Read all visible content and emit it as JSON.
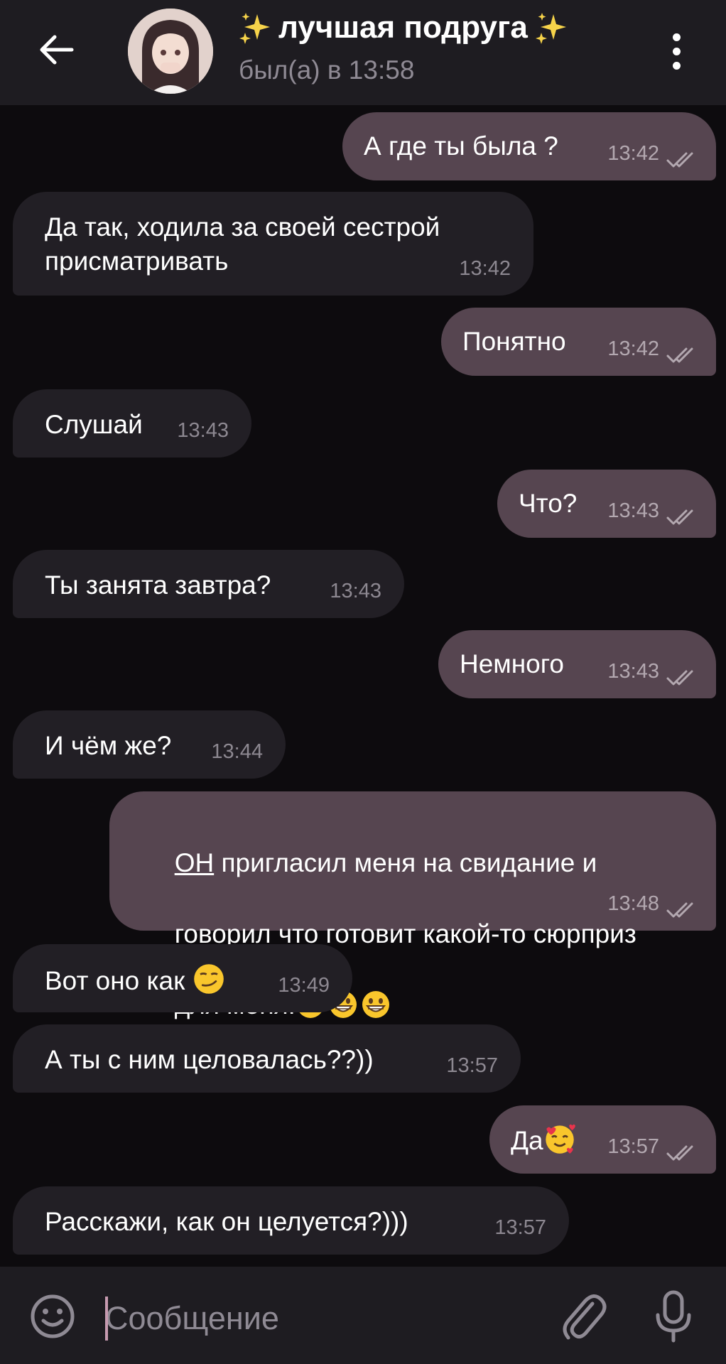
{
  "header": {
    "title": "лучшая подруга",
    "status": "был(а) в 13:58",
    "title_icons": [
      "sparkles-icon",
      "sparkles-icon"
    ]
  },
  "messages": [
    {
      "dir": "out",
      "text": "А где ты была ?",
      "time": "13:42",
      "read": true
    },
    {
      "dir": "in",
      "text": "Да так, ходила за своей сестрой\nприсматривать",
      "time": "13:42"
    },
    {
      "dir": "out",
      "text": "Понятно",
      "time": "13:42",
      "read": true
    },
    {
      "dir": "in",
      "text": "Слушай",
      "time": "13:43"
    },
    {
      "dir": "out",
      "text": "Что?",
      "time": "13:43",
      "read": true
    },
    {
      "dir": "in",
      "text": "Ты занята завтра?",
      "time": "13:43"
    },
    {
      "dir": "out",
      "text": "Немного",
      "time": "13:43",
      "read": true
    },
    {
      "dir": "in",
      "text": "И чём же?",
      "time": "13:44"
    },
    {
      "dir": "out",
      "text_underlined": "ОН",
      "text_line1": " пригласил меня на свидание и",
      "text_line2": "говорил что готовит какой-то сюрприз",
      "text_line3": "для меня!",
      "emojis": [
        "grinning-face-emoji",
        "grinning-face-emoji",
        "grinning-face-emoji"
      ],
      "time": "13:48",
      "read": true
    },
    {
      "dir": "in",
      "text": "Вот оно как",
      "emoji": "smirking-face-emoji",
      "time": "13:49"
    },
    {
      "dir": "in",
      "text": "А ты с ним целовалась??))",
      "time": "13:57"
    },
    {
      "dir": "out",
      "text": "Да",
      "emoji": "smiling-face-with-hearts-emoji",
      "time": "13:57",
      "read": true
    },
    {
      "dir": "in",
      "text": "Расскажи, как он целуется?)))",
      "time": "13:57"
    }
  ],
  "input": {
    "placeholder": "Сообщение"
  },
  "colors": {
    "background": "#0d0b0e",
    "bar": "#1e1c21",
    "incoming_bubble": "#221f25",
    "outgoing_bubble": "#564550",
    "time_text": "#8d8891",
    "cursor": "#c79ab0"
  }
}
